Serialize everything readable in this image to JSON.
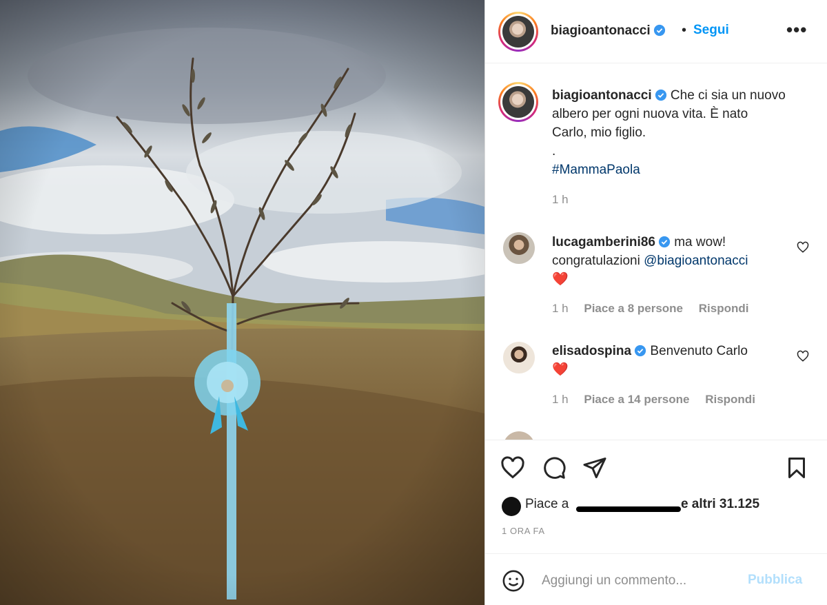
{
  "post": {
    "author": "biagioantonacci",
    "follow_label": "Segui",
    "more_label": "•••",
    "separator": "•"
  },
  "caption": {
    "username": "biagioantonacci",
    "text_line1": "Che ci sia un nuovo",
    "text_line2": "albero per ogni nuova vita. È nato",
    "text_line3": "Carlo, mio figlio.",
    "dot": ".",
    "hashtag": "#MammaPaola",
    "time": "1 h"
  },
  "comments": [
    {
      "username": "lucagamberini86",
      "text_start": "ma wow!",
      "text_line2": "congratulazioni",
      "mention": "@biagioantonacci",
      "emoji": "❤️",
      "time": "1 h",
      "likes": "Piace a 8 persone",
      "reply": "Rispondi"
    },
    {
      "username": "elisadospina",
      "text_start": "Benvenuto Carlo",
      "emoji": "❤️",
      "time": "1 h",
      "likes": "Piace a 14 persone",
      "reply": "Rispondi"
    }
  ],
  "likes": {
    "prefix": "Piace a",
    "suffix": "e altri 31.125"
  },
  "time_ago": "1 ORA FA",
  "comment_box": {
    "placeholder": "Aggiungi un commento...",
    "publish_label": "Pubblica"
  },
  "colors": {
    "accent_blue": "#0095f6",
    "link_blue": "#00376b",
    "verified_blue": "#3897f0",
    "heart_red": "#ed4956",
    "muted_gray": "#8e8e8e",
    "publish_disabled": "#b2dffc",
    "ribbon_blue": "#7fd3ef"
  },
  "icons": [
    "verified-badge-icon",
    "more-options-icon",
    "heart-icon",
    "comment-icon",
    "share-icon",
    "bookmark-icon",
    "emoji-icon"
  ]
}
